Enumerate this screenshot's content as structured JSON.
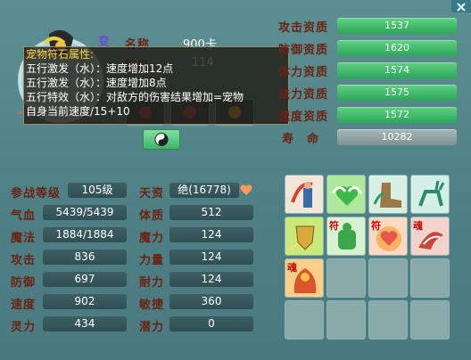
{
  "pet": {
    "name_label": "名称",
    "name_value": "900卡",
    "level_label": "等级",
    "level_value": "114",
    "transform_badge": "变"
  },
  "tooltip": {
    "title": "宠物符石属性:",
    "lines": [
      "五行激发（水）：速度增加12点",
      "五行激发（水）：速度增加8点",
      "五行特效（水）：对敌方的伤害结果增加=宠物",
      "自身当前速度/15+10"
    ]
  },
  "aptitudes": [
    {
      "label": "攻击资质",
      "value": "1537"
    },
    {
      "label": "防御资质",
      "value": "1620"
    },
    {
      "label": "体力资质",
      "value": "1574"
    },
    {
      "label": "法力资质",
      "value": "1575"
    },
    {
      "label": "速度资质",
      "value": "1572"
    }
  ],
  "lifespan": {
    "label": "寿　命",
    "value": "10282"
  },
  "stats_left": [
    {
      "label": "参战等级",
      "value": "105级"
    },
    {
      "label": "气血",
      "value": "5439/5439"
    },
    {
      "label": "魔法",
      "value": "1884/1884"
    },
    {
      "label": "攻击",
      "value": "836"
    },
    {
      "label": "防御",
      "value": "697"
    },
    {
      "label": "速度",
      "value": "902"
    },
    {
      "label": "灵力",
      "value": "434"
    }
  ],
  "stats_right": [
    {
      "label": "天资",
      "value": "绝(16778)"
    },
    {
      "label": "体质",
      "value": "512"
    },
    {
      "label": "魔力",
      "value": "124"
    },
    {
      "label": "力量",
      "value": "124"
    },
    {
      "label": "耐力",
      "value": "124"
    },
    {
      "label": "敏捷",
      "value": "360"
    },
    {
      "label": "潜力",
      "value": "0"
    }
  ],
  "skills": [
    {
      "name": "skill-1",
      "color": "#d9432c"
    },
    {
      "name": "skill-2",
      "color": "#5fcf5a"
    },
    {
      "name": "skill-3",
      "color": "#8a6a3a"
    },
    {
      "name": "skill-4",
      "color": "#2c8a6e"
    },
    {
      "name": "skill-5",
      "color": "#d9a93a"
    },
    {
      "name": "skill-6",
      "color": "#3aa84a"
    },
    {
      "name": "skill-7",
      "color": "#e8584a"
    },
    {
      "name": "skill-8",
      "color": "#c9463a"
    },
    {
      "name": "skill-9",
      "color": "#d9552a"
    }
  ],
  "skill_slot_text": {
    "fu": "符",
    "hun": "魂"
  },
  "colors": {
    "accent_green": "#2aa65a",
    "label_brown": "#6b2313"
  }
}
